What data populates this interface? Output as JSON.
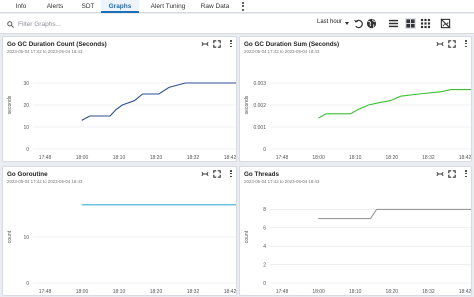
{
  "tabs": [
    {
      "label": "Info",
      "active": false
    },
    {
      "label": "Alerts",
      "active": false
    },
    {
      "label": "SDT",
      "active": false
    },
    {
      "label": "Graphs",
      "active": true
    },
    {
      "label": "Alert Tuning",
      "active": false
    },
    {
      "label": "Raw Data",
      "active": false
    }
  ],
  "toolbar": {
    "filter_placeholder": "Filter Graphs...",
    "time_range": "Last hour",
    "icons": [
      "search-icon",
      "undo-icon",
      "globe-icon",
      "list-view-icon",
      "grid-view-icon",
      "tile-view-icon",
      "no-image-icon"
    ]
  },
  "panels": [
    {
      "title": "Go GC Duration Count (Seconds)",
      "range": "2023-05-04 17:42 to 2023-05-04 18:43",
      "chart_data": {
        "type": "line",
        "ylabel": "seconds",
        "ylim": [
          0,
          40
        ],
        "yticks": [
          "0",
          "10",
          "20",
          "30"
        ],
        "xticks": [
          "17:48",
          "18:00",
          "18:10",
          "18:20",
          "18:32",
          "18:42"
        ],
        "series": [
          {
            "color": "#2c4f8f",
            "points": [
              [
                0.24,
                13
              ],
              [
                0.28,
                15
              ],
              [
                0.38,
                15
              ],
              [
                0.41,
                18
              ],
              [
                0.44,
                20
              ],
              [
                0.47,
                21
              ],
              [
                0.5,
                22
              ],
              [
                0.54,
                25
              ],
              [
                0.62,
                25
              ],
              [
                0.67,
                28
              ],
              [
                0.75,
                30
              ],
              [
                1.0,
                30
              ]
            ]
          }
        ]
      }
    },
    {
      "title": "Go GC Duration Sum (Seconds)",
      "range": "2023-05-04 17:42 to 2023-05-04 18:43",
      "chart_data": {
        "type": "line",
        "ylabel": "seconds",
        "ylim": [
          0,
          0.004
        ],
        "yticks": [
          "0",
          "0.001",
          "0.002",
          "0.003"
        ],
        "xticks": [
          "17:48",
          "18:00",
          "18:10",
          "18:20",
          "18:32",
          "18:42"
        ],
        "series": [
          {
            "color": "#3cbf35",
            "points": [
              [
                0.24,
                0.0014
              ],
              [
                0.28,
                0.0016
              ],
              [
                0.4,
                0.0016
              ],
              [
                0.44,
                0.0018
              ],
              [
                0.49,
                0.002
              ],
              [
                0.54,
                0.0021
              ],
              [
                0.6,
                0.0022
              ],
              [
                0.65,
                0.0024
              ],
              [
                0.74,
                0.0025
              ],
              [
                0.85,
                0.0026
              ],
              [
                0.9,
                0.0027
              ],
              [
                1.0,
                0.0027
              ]
            ]
          }
        ]
      }
    },
    {
      "title": "Go Goroutine",
      "range": "2023-05-04 17:42 to 2023-05-04 18:43",
      "chart_data": {
        "type": "line",
        "ylabel": "count",
        "ylim": [
          0,
          20
        ],
        "yticks": [
          "0",
          "10"
        ],
        "xticks": [
          "17:48",
          "18:00",
          "18:10",
          "18:20",
          "18:32",
          "18:42"
        ],
        "series": [
          {
            "color": "#3ab0d8",
            "points": [
              [
                0.24,
                17
              ],
              [
                1.0,
                17
              ]
            ]
          }
        ]
      }
    },
    {
      "title": "Go Threads",
      "range": "2023-05-04 17:42 to 2023-05-04 18:43",
      "chart_data": {
        "type": "line",
        "ylabel": "count",
        "ylim": [
          0,
          10
        ],
        "yticks": [
          "0",
          "2",
          "4",
          "6",
          "8"
        ],
        "xticks": [
          "17:48",
          "18:00",
          "18:10",
          "18:20",
          "18:32",
          "18:42"
        ],
        "series": [
          {
            "color": "#999999",
            "points": [
              [
                0.24,
                7
              ],
              [
                0.5,
                7
              ],
              [
                0.53,
                8
              ],
              [
                1.0,
                8
              ]
            ]
          }
        ]
      }
    }
  ]
}
